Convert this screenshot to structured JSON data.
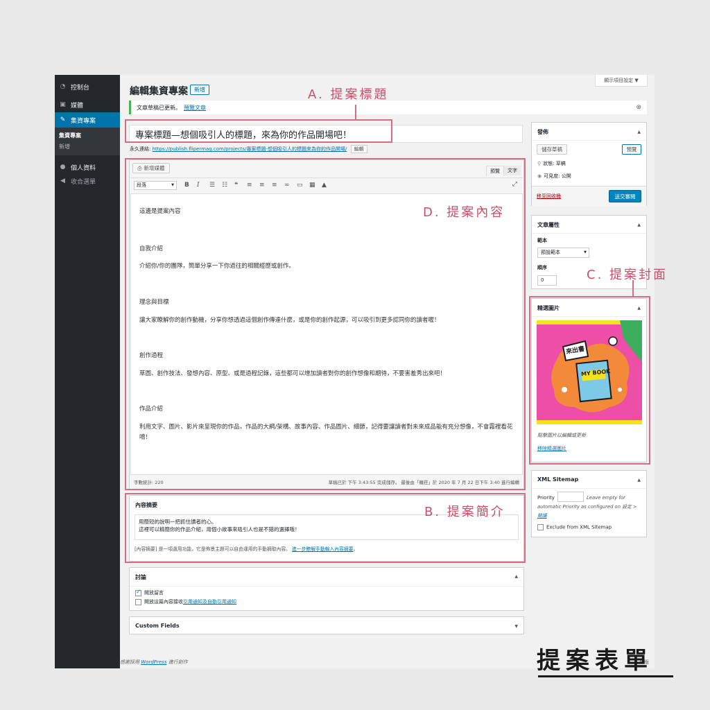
{
  "menu": {
    "dashboard": "控制台",
    "media": "媒體",
    "projects": "集資專案",
    "projects_sub": [
      "集資專案",
      "新增"
    ],
    "profile": "個人資料",
    "collapse": "收合選單"
  },
  "screen_options": "顯示項目設定 ▼",
  "header": {
    "title": "編輯集資專案",
    "add_new": "新增"
  },
  "notice": {
    "text": "文章草稿已更新。",
    "link": "預覽文章"
  },
  "post_title": "專案標題—想個吸引人的標題，來為你的作品開場吧！",
  "permalink": {
    "label": "永久連結:",
    "url": "https://publish.flipermag.com/projects/專案標題-想個吸引人的標題來為你的作品開場/",
    "edit": "編輯"
  },
  "editor": {
    "add_media": "新增媒體",
    "tab_visual": "預覽",
    "tab_text": "文字",
    "format_select": "段落",
    "paragraphs": [
      "這邊是提案內容",
      "自我介紹",
      "介紹你/你的團隊，簡單分享一下你過往的相關經歷或創作。",
      "理念與目標",
      "讓大家瞭解你的創作動機，分享你想透過這個創作傳達什麼，或是你的創作起源，可以吸引到更多認同你的讀者喔！",
      "創作過程",
      "草圖、創作技法、發想內容、原型、或是過程記錄，這些都可以增加讀者對你的創作想像和期待，不要害羞秀出來吧！",
      "作品介紹",
      "利用文字、圖片、影片來呈現你的作品，作品的大綱/架構、故事內容、作品圖片、細節，記得要讓讀者對未來成品能有充分想像，不會霧裡看花唷！"
    ],
    "word_count": "字數統計: 220",
    "last_saved": "草稿已於 下午 3:43:55 完成儲存。 最後由「羅莊」於 2020 年 7 月 22 日下午 3:40 進行編輯"
  },
  "excerpt": {
    "title": "內容摘要",
    "text_line1": "用簡短的說明一把抓住讀者的心。",
    "text_line2": "這裡可以精簡你的作品介紹，用個小故事來吸引人也是不錯的選擇哦！",
    "help": "[內容摘要] 是一項選用功能，它是佈景主題可以自由運用的手動摘取內容。",
    "help_link": "進一步瞭解手動輸入內容摘要"
  },
  "discussion": {
    "title": "討論",
    "allow_comments": "開放留言",
    "allow_pings_prefix": "開放這篇內容接收",
    "allow_pings_link": "引用通知及自動引用通知"
  },
  "custom_fields": {
    "title": "Custom Fields"
  },
  "publish": {
    "title": "發佈",
    "save_draft": "儲存草稿",
    "preview": "預覽",
    "status": "狀態: 草稿",
    "visibility": "可見度: 公開",
    "trash": "移至回收桶",
    "submit": "送交審閱"
  },
  "attributes": {
    "title": "文章屬性",
    "template_label": "範本",
    "template_value": "預設範本",
    "order_label": "順序",
    "order_value": "0"
  },
  "featured": {
    "title": "精選圖片",
    "book_title": "MY BOOK",
    "sticker": "來出書",
    "hint": "點擊圖片以編輯或更新",
    "remove": "移除精選圖片"
  },
  "sitemap": {
    "title": "XML Sitemap",
    "priority_label": "Priority",
    "hint": "Leave empty for automatic Priority as configured on 設定 >",
    "hint_link": "閱讀",
    "exclude": "Exclude from XML Sitemap"
  },
  "footer": {
    "credit_prefix": "感謝採用",
    "credit_link": "WordPress",
    "credit_suffix": "進行創作",
    "version": "5.6 版"
  },
  "annotations": {
    "a": "A. 提案標題",
    "b": "B. 提案簡介",
    "c": "C. 提案封面",
    "d": "D. 提案內容"
  },
  "corner_title": "提案表單",
  "colors": {
    "annotation": "#d96c83",
    "admin_bar": "#23282d",
    "primary": "#0085ba",
    "cover_pink": "#ee4fa6",
    "cover_yellow": "#f4e21a"
  }
}
